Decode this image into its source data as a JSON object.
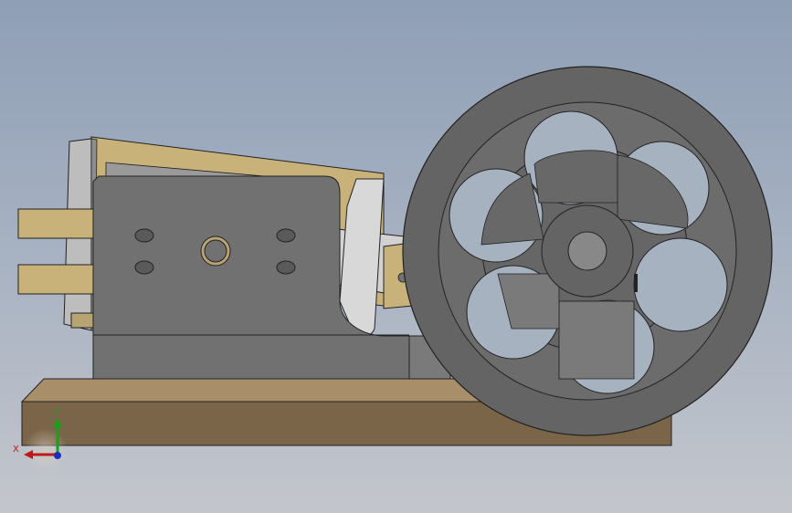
{
  "viewport": {
    "background_top": "#8f9fb6",
    "background_bottom": "#c3c6cc"
  },
  "model": {
    "colors": {
      "brass": "#b8a472",
      "brass_light": "#c9b27a",
      "steel": "#717171",
      "steel_dark": "#646464",
      "silver": "#d8d8d8",
      "wood": "#7a6548",
      "wood_top": "#a98e6a"
    }
  },
  "triad": {
    "x_label": "X",
    "y_label": "Y",
    "x_color": "#c01818",
    "y_color": "#18a018",
    "z_color": "#1a2fc0"
  }
}
